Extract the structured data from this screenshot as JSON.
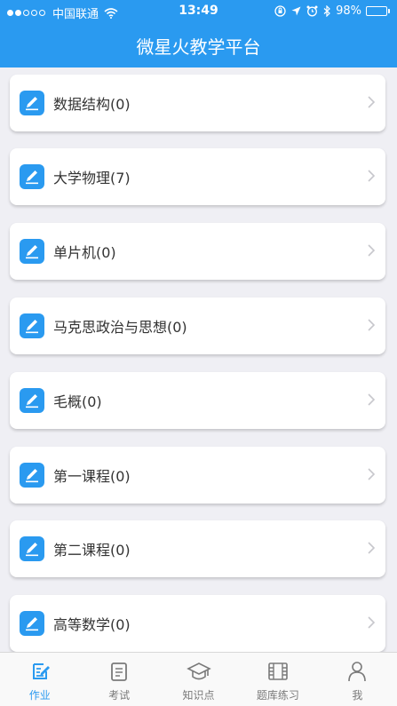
{
  "status_bar": {
    "carrier": "中国联通",
    "time": "13:49",
    "battery": "98%",
    "battery_level": 0.98
  },
  "header": {
    "title": "微星火教学平台"
  },
  "courses": [
    {
      "label": "数据结构(0)"
    },
    {
      "label": "大学物理(7)"
    },
    {
      "label": "单片机(0)"
    },
    {
      "label": "马克思政治与思想(0)"
    },
    {
      "label": "毛概(0)"
    },
    {
      "label": "第一课程(0)"
    },
    {
      "label": "第二课程(0)"
    },
    {
      "label": "高等数学(0)"
    }
  ],
  "tabs": [
    {
      "label": "作业",
      "icon": "homework-icon",
      "active": true
    },
    {
      "label": "考试",
      "icon": "exam-icon",
      "active": false
    },
    {
      "label": "知识点",
      "icon": "graduation-cap-icon",
      "active": false
    },
    {
      "label": "题库练习",
      "icon": "film-strip-icon",
      "active": false
    },
    {
      "label": "我",
      "icon": "user-icon",
      "active": false
    }
  ],
  "colors": {
    "accent": "#2a9af0",
    "background": "#efeff4",
    "inactive": "#7a7a7a"
  }
}
